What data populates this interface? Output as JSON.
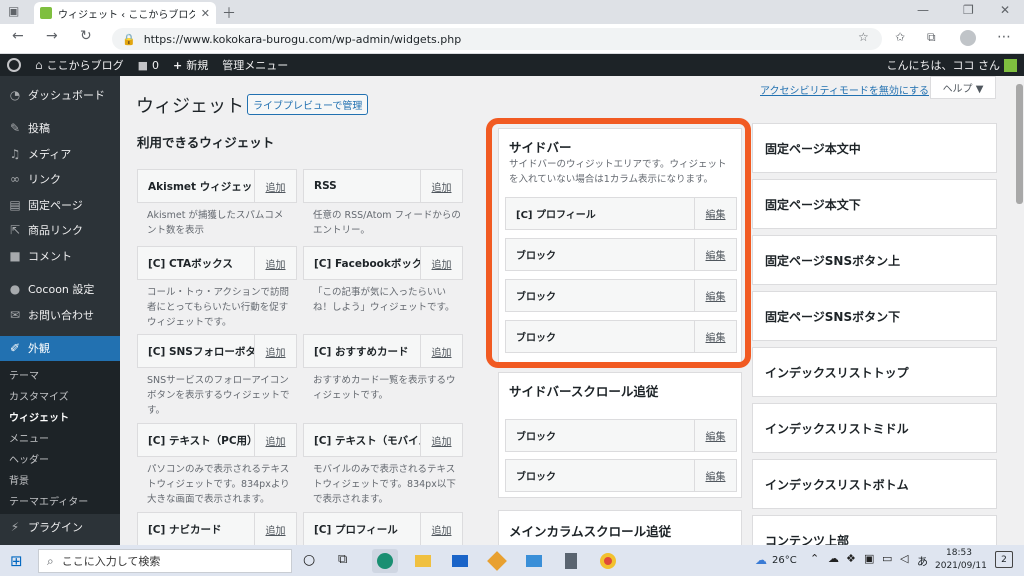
{
  "browser": {
    "tab_title": "ウィジェット ‹ ここからブログ — WordP",
    "url": "https://www.kokokara-burogu.com/wp-admin/widgets.php"
  },
  "admin_bar": {
    "site_name": "ここからブログ",
    "comments_count": "0",
    "new_label": "新規",
    "manage_menu": "管理メニュー",
    "greeting": "こんにちは、ココ さん"
  },
  "sidebar": {
    "items": [
      {
        "label": "ダッシュボード",
        "icon": "dashboard-icon"
      },
      {
        "label": "投稿",
        "icon": "pin-icon"
      },
      {
        "label": "メディア",
        "icon": "media-icon"
      },
      {
        "label": "リンク",
        "icon": "link-icon"
      },
      {
        "label": "固定ページ",
        "icon": "page-icon"
      },
      {
        "label": "商品リンク",
        "icon": "external-link-icon"
      },
      {
        "label": "コメント",
        "icon": "comment-icon"
      },
      {
        "label": "Cocoon 設定",
        "icon": "cocoon-icon"
      },
      {
        "label": "お問い合わせ",
        "icon": "mail-icon"
      },
      {
        "label": "外観",
        "icon": "brush-icon"
      }
    ],
    "sub_items": [
      "テーマ",
      "カスタマイズ",
      "ウィジェット",
      "メニュー",
      "ヘッダー",
      "背景",
      "テーマエディター"
    ],
    "plugins": "プラグイン"
  },
  "page": {
    "title": "ウィジェット",
    "live_preview_button": "ライブプレビューで管理",
    "accessibility_link": "アクセシビリティモードを無効にする",
    "help_button": "ヘルプ ▼",
    "available_heading": "利用できるウィジェット"
  },
  "widgets": [
    {
      "name": "Akismet ウィジェット",
      "add": "追加",
      "desc1": "Akismet が捕獲したスパムコメ",
      "desc2": "ント数を表示",
      "desc3": ""
    },
    {
      "name": "RSS",
      "add": "追加",
      "desc1": "任意の RSS/Atom フィードからの",
      "desc2": "エントリー。",
      "desc3": ""
    },
    {
      "name": "[C] CTAボックス",
      "add": "追加",
      "desc1": "コール・トゥ・アクションで訪問",
      "desc2": "者にとってもらいたい行動を促す",
      "desc3": "ウィジェットです。"
    },
    {
      "name": "[C] Facebookボックス",
      "add": "追加",
      "desc1": "「この記事が気に入ったらいい",
      "desc2": "ね！しよう」ウィジェットです。",
      "desc3": ""
    },
    {
      "name": "[C] SNSフォローボタン",
      "add": "追加",
      "desc1": "SNSサービスのフォローアイコン",
      "desc2": "ボタンを表示するウィジェットで",
      "desc3": "す。"
    },
    {
      "name": "[C] おすすめカード",
      "add": "追加",
      "desc1": "おすすめカード一覧を表示するウ",
      "desc2": "ィジェットです。",
      "desc3": ""
    },
    {
      "name": "[C] テキスト（PC用）",
      "add": "追加",
      "desc1": "パソコンのみで表示されるテキス",
      "desc2": "トウィジェットです。834pxより",
      "desc3": "大きな画面で表示されます。"
    },
    {
      "name": "[C] テキスト（モバイル用）",
      "add": "追加",
      "desc1": "モバイルのみで表示されるテキス",
      "desc2": "トウィジェットです。834px以下",
      "desc3": "で表示されます。"
    },
    {
      "name": "[C] ナビカード",
      "add": "追加",
      "desc1": "",
      "desc2": "",
      "desc3": ""
    },
    {
      "name": "[C] プロフィール",
      "add": "追加",
      "desc1": "",
      "desc2": "",
      "desc3": ""
    }
  ],
  "sidebar_area": {
    "title": "サイドバー",
    "desc1": "サイドバーのウィジットエリアです。ウィジェット",
    "desc2": "を入れていない場合は1カラム表示になります。",
    "items": [
      {
        "name": "[C] プロフィール",
        "edit": "編集"
      },
      {
        "name": "ブロック",
        "edit": "編集"
      },
      {
        "name": "ブロック",
        "edit": "編集"
      },
      {
        "name": "ブロック",
        "edit": "編集"
      }
    ]
  },
  "scroll_area": {
    "title": "サイドバースクロール追従",
    "items": [
      {
        "name": "ブロック",
        "edit": "編集"
      },
      {
        "name": "ブロック",
        "edit": "編集"
      }
    ]
  },
  "main_scroll_area": {
    "title": "メインカラムスクロール追従"
  },
  "right_areas": [
    "固定ページ本文中",
    "固定ページ本文下",
    "固定ページSNSボタン上",
    "固定ページSNSボタン下",
    "インデックスリストトップ",
    "インデックスリストミドル",
    "インデックスリストボトム",
    "コンテンツ上部"
  ],
  "highlight_color": "#f15a22",
  "taskbar": {
    "search_placeholder": "ここに入力して検索",
    "weather": "26°C",
    "ime": "あ",
    "time": "18:53",
    "date": "2021/09/11",
    "notifications": "2"
  }
}
